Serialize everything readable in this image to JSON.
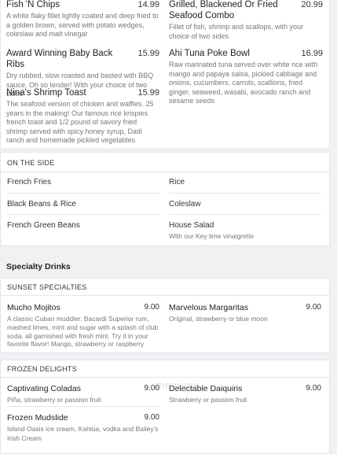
{
  "top_items": [
    {
      "name": "Fish 'N Chips",
      "price": "14.99",
      "desc": "A white flaky fillet lightly coated and deep fried to a golden brown, served with potato wedges, coleslaw and malt vinegar"
    },
    {
      "name": "Grilled, Blackened Or Fried Seafood Combo",
      "price": "20.99",
      "desc": "Fillet of fish, shrimp and scallops, with your choice of two sides"
    },
    {
      "name": "Award Winning Baby Back Ribs",
      "price": "15.99",
      "desc": "Dry rubbed, slow roasted and basted with BBQ sauce. Oh so tender! With your choice of two sides"
    },
    {
      "name": "Ahi Tuna Poke Bowl",
      "price": "16.99",
      "desc": "Raw marinated tuna served over white rice with mango and papaya salsa, pickled cabbage and onions, cucumbers, carrots, scallions, fried ginger, seaweed, wasabi, avocado ranch and sesame seeds"
    },
    {
      "name": "Nina's Shrimp Toast",
      "price": "15.99",
      "desc": "The seafood version of chicken and waffles. 25 years in the making! Our famous rice krispies french toast and 1/2 pound of savory fried shrimp served with spicy honey syrup, Datil ranch and homemade pickled vegetables"
    }
  ],
  "on_the_side": {
    "label": "ON THE SIDE",
    "items": [
      {
        "name": "French Fries",
        "desc": ""
      },
      {
        "name": "Rice",
        "desc": ""
      },
      {
        "name": "Black Beans & Rice",
        "desc": ""
      },
      {
        "name": "Coleslaw",
        "desc": ""
      },
      {
        "name": "French Green Beans",
        "desc": ""
      },
      {
        "name": "House Salad",
        "desc": "With our Key lime vinaigrette"
      }
    ]
  },
  "specialty_drinks": {
    "title": "Specialty Drinks",
    "sunset": {
      "label": "SUNSET SPECIALTIES",
      "items": [
        {
          "name": "Mucho Mojitos",
          "price": "9.00",
          "desc": "A classic Cuban muddler. Bacardi Superior rum, mashed limes, mint and sugar with a splash of club soda, all garnished with fresh mint. Try it in your favorite flavor! Mango, strawberry or raspberry"
        },
        {
          "name": "Marvelous Margaritas",
          "price": "9.00",
          "desc": "Original, strawberry or blue moon"
        }
      ]
    },
    "frozen": {
      "label": "FROZEN DELIGHTS",
      "items": [
        {
          "name": "Captivating Coladas",
          "price": "9.00",
          "desc": "Piña, strawberry or passion fruit"
        },
        {
          "name": "Delectable Daiquiris",
          "price": "9.00",
          "desc": "Strawberry or passion fruit"
        },
        {
          "name": "Frozen Mudslide",
          "price": "9.00",
          "desc": "Island Oasis ice cream, Kahlúa, vodka and Bailey's Irish Cream"
        }
      ]
    }
  },
  "watermark": "menupix"
}
